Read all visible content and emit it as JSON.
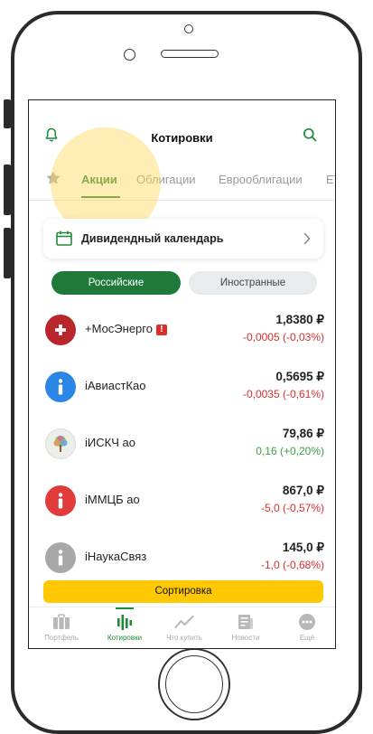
{
  "header": {
    "title": "Котировки",
    "bell_icon": "bell-icon",
    "search_icon": "search-icon"
  },
  "tabs": [
    {
      "label": "Акции",
      "active": true
    },
    {
      "label": "Облигации"
    },
    {
      "label": "Еврооблигации"
    },
    {
      "label": "ET"
    }
  ],
  "dividend_card": {
    "label": "Дивидендный календарь"
  },
  "segments": {
    "russian": "Российские",
    "foreign": "Иностранные",
    "selected": "russian"
  },
  "quotes": [
    {
      "name": "+МосЭнерго",
      "price": "1,8380 ₽",
      "change": "-0,0005 (-0,03%)",
      "trend": "neg",
      "flag": "!",
      "avatar_color": "#b8262c",
      "avatar_symbol": "+"
    },
    {
      "name": "iАвиастКао",
      "price": "0,5695 ₽",
      "change": "-0,0035 (-0,61%)",
      "trend": "neg",
      "avatar_color": "#2b86e6",
      "avatar_symbol": "i"
    },
    {
      "name": "iИСКЧ ао",
      "price": "79,86 ₽",
      "change": "0,16 (+0,20%)",
      "trend": "pos",
      "avatar_color": "#e9ecef",
      "avatar_symbol": "tree"
    },
    {
      "name": "iММЦБ ао",
      "price": "867,0 ₽",
      "change": "-5,0 (-0,57%)",
      "trend": "neg",
      "avatar_color": "#e23b3b",
      "avatar_symbol": "i"
    },
    {
      "name": "iНаукаСвяз",
      "price": "145,0 ₽",
      "change": "-1,0 (-0,68%)",
      "trend": "neg",
      "avatar_color": "#a8a8a8",
      "avatar_symbol": "i"
    }
  ],
  "sort_button": {
    "label": "Сортировка"
  },
  "bottom_nav": [
    {
      "label": "Портфель",
      "icon": "briefcase-icon"
    },
    {
      "label": "Котировки",
      "icon": "quotes-icon",
      "active": true
    },
    {
      "label": "Что купить",
      "icon": "trend-icon"
    },
    {
      "label": "Новости",
      "icon": "news-icon"
    },
    {
      "label": "Ещё",
      "icon": "more-icon"
    }
  ],
  "colors": {
    "accent": "#1f8a3c",
    "negative": "#d8302f",
    "positive": "#3aa341",
    "sort_button": "#ffc800"
  }
}
